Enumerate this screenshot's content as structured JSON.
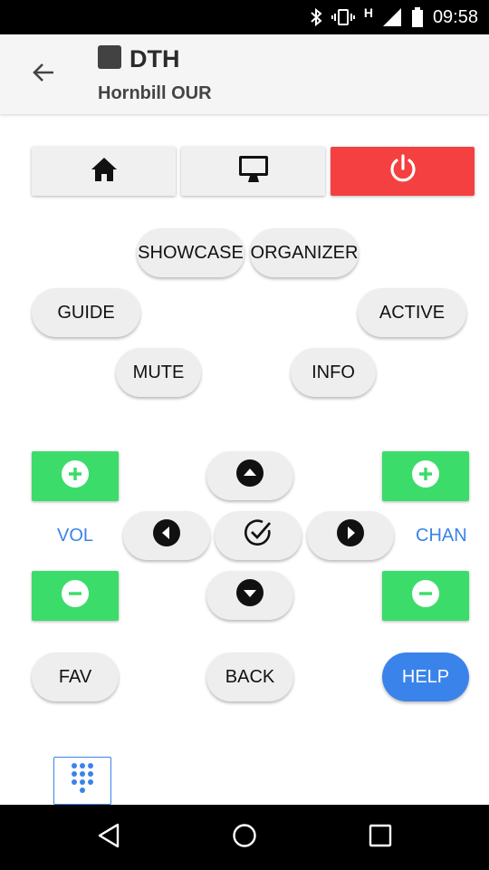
{
  "status_bar": {
    "time": "09:58",
    "network_indicator": "H",
    "icons": [
      "bluetooth-icon",
      "vibrate-icon",
      "signal-icon",
      "battery-icon"
    ]
  },
  "app_bar": {
    "title": "DTH",
    "subtitle": "Hornbill OUR",
    "back_icon": "arrow-back-icon"
  },
  "top_buttons": [
    {
      "name": "home",
      "icon": "home-icon"
    },
    {
      "name": "tv",
      "icon": "monitor-icon"
    },
    {
      "name": "power",
      "icon": "power-icon",
      "color": "#f44040"
    }
  ],
  "buttons": {
    "showcase": "SHOWCASE",
    "organizer": "ORGANIZER",
    "guide": "GUIDE",
    "active": "ACTIVE",
    "mute": "MUTE",
    "info": "INFO",
    "fav": "FAV",
    "back": "BACK",
    "help": "HELP"
  },
  "volume": {
    "label": "VOL",
    "up_icon": "plus-circle-icon",
    "down_icon": "minus-circle-icon"
  },
  "channel": {
    "label": "CHAN",
    "up_icon": "plus-circle-icon",
    "down_icon": "minus-circle-icon"
  },
  "dpad": {
    "up": "arrow-up-circle-icon",
    "down": "arrow-down-circle-icon",
    "left": "arrow-left-circle-icon",
    "right": "arrow-right-circle-icon",
    "ok": "check-circle-icon"
  },
  "keypad_icon": "dialpad-icon",
  "nav_bar": [
    "back-triangle-icon",
    "home-circle-icon",
    "recents-square-icon"
  ],
  "colors": {
    "accent_blue": "#3a83ea",
    "power_red": "#f44040",
    "green": "#3cdc6a",
    "button_gray": "#eeeeee"
  }
}
